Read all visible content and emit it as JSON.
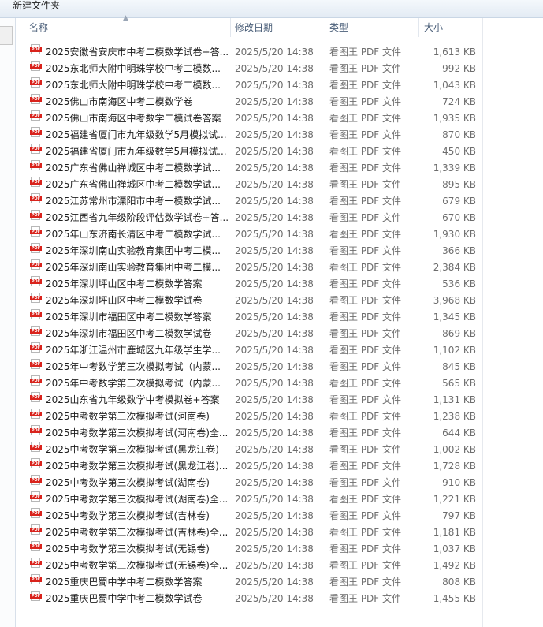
{
  "window": {
    "title": "新建文件夹"
  },
  "columns": {
    "name": "名称",
    "date": "修改日期",
    "type": "类型",
    "size": "大小"
  },
  "files": [
    {
      "name": "2025安徽省安庆市中考二模数学试卷+答...",
      "date": "2025/5/20 14:38",
      "type": "看图王 PDF 文件",
      "size": "1,613 KB"
    },
    {
      "name": "2025东北师大附中明珠学校中考二模数...",
      "date": "2025/5/20 14:38",
      "type": "看图王 PDF 文件",
      "size": "992 KB"
    },
    {
      "name": "2025东北师大附中明珠学校中考二模数...",
      "date": "2025/5/20 14:38",
      "type": "看图王 PDF 文件",
      "size": "1,043 KB"
    },
    {
      "name": "2025佛山市南海区中考二模数学卷",
      "date": "2025/5/20 14:38",
      "type": "看图王 PDF 文件",
      "size": "724 KB"
    },
    {
      "name": "2025佛山市南海区中考数学二模试卷答案",
      "date": "2025/5/20 14:38",
      "type": "看图王 PDF 文件",
      "size": "1,935 KB"
    },
    {
      "name": "2025福建省厦门市九年级数学5月模拟试...",
      "date": "2025/5/20 14:38",
      "type": "看图王 PDF 文件",
      "size": "870 KB"
    },
    {
      "name": "2025福建省厦门市九年级数学5月模拟试...",
      "date": "2025/5/20 14:38",
      "type": "看图王 PDF 文件",
      "size": "450 KB"
    },
    {
      "name": "2025广东省佛山禅城区中考二模数学试...",
      "date": "2025/5/20 14:38",
      "type": "看图王 PDF 文件",
      "size": "1,339 KB"
    },
    {
      "name": "2025广东省佛山禅城区中考二模数学试...",
      "date": "2025/5/20 14:38",
      "type": "看图王 PDF 文件",
      "size": "895 KB"
    },
    {
      "name": "2025江苏常州市溧阳市中考一模数学试...",
      "date": "2025/5/20 14:38",
      "type": "看图王 PDF 文件",
      "size": "679 KB"
    },
    {
      "name": "2025江西省九年级阶段评估数学试卷+答...",
      "date": "2025/5/20 14:38",
      "type": "看图王 PDF 文件",
      "size": "670 KB"
    },
    {
      "name": "2025年山东济南长清区中考二模数学试...",
      "date": "2025/5/20 14:38",
      "type": "看图王 PDF 文件",
      "size": "1,930 KB"
    },
    {
      "name": "2025年深圳南山实验教育集团中考二模...",
      "date": "2025/5/20 14:38",
      "type": "看图王 PDF 文件",
      "size": "366 KB"
    },
    {
      "name": "2025年深圳南山实验教育集团中考二模...",
      "date": "2025/5/20 14:38",
      "type": "看图王 PDF 文件",
      "size": "2,384 KB"
    },
    {
      "name": "2025年深圳坪山区中考二模数学答案",
      "date": "2025/5/20 14:38",
      "type": "看图王 PDF 文件",
      "size": "536 KB"
    },
    {
      "name": "2025年深圳坪山区中考二模数学试卷",
      "date": "2025/5/20 14:38",
      "type": "看图王 PDF 文件",
      "size": "3,968 KB"
    },
    {
      "name": "2025年深圳市福田区中考二模数学答案",
      "date": "2025/5/20 14:38",
      "type": "看图王 PDF 文件",
      "size": "1,345 KB"
    },
    {
      "name": "2025年深圳市福田区中考二模数学试卷",
      "date": "2025/5/20 14:38",
      "type": "看图王 PDF 文件",
      "size": "869 KB"
    },
    {
      "name": "2025年浙江温州市鹿城区九年级学生学...",
      "date": "2025/5/20 14:38",
      "type": "看图王 PDF 文件",
      "size": "1,102 KB"
    },
    {
      "name": "2025年中考数学第三次模拟考试（内蒙...",
      "date": "2025/5/20 14:38",
      "type": "看图王 PDF 文件",
      "size": "845 KB"
    },
    {
      "name": "2025年中考数学第三次模拟考试（内蒙...",
      "date": "2025/5/20 14:38",
      "type": "看图王 PDF 文件",
      "size": "565 KB"
    },
    {
      "name": "2025山东省九年级数学中考模拟卷+答案",
      "date": "2025/5/20 14:38",
      "type": "看图王 PDF 文件",
      "size": "1,131 KB"
    },
    {
      "name": "2025中考数学第三次模拟考试(河南卷)",
      "date": "2025/5/20 14:38",
      "type": "看图王 PDF 文件",
      "size": "1,238 KB"
    },
    {
      "name": "2025中考数学第三次模拟考试(河南卷)全...",
      "date": "2025/5/20 14:38",
      "type": "看图王 PDF 文件",
      "size": "644 KB"
    },
    {
      "name": "2025中考数学第三次模拟考试(黑龙江卷)",
      "date": "2025/5/20 14:38",
      "type": "看图王 PDF 文件",
      "size": "1,002 KB"
    },
    {
      "name": "2025中考数学第三次模拟考试(黑龙江卷)...",
      "date": "2025/5/20 14:38",
      "type": "看图王 PDF 文件",
      "size": "1,728 KB"
    },
    {
      "name": "2025中考数学第三次模拟考试(湖南卷)",
      "date": "2025/5/20 14:38",
      "type": "看图王 PDF 文件",
      "size": "910 KB"
    },
    {
      "name": "2025中考数学第三次模拟考试(湖南卷)全...",
      "date": "2025/5/20 14:38",
      "type": "看图王 PDF 文件",
      "size": "1,221 KB"
    },
    {
      "name": "2025中考数学第三次模拟考试(吉林卷)",
      "date": "2025/5/20 14:38",
      "type": "看图王 PDF 文件",
      "size": "797 KB"
    },
    {
      "name": "2025中考数学第三次模拟考试(吉林卷)全...",
      "date": "2025/5/20 14:38",
      "type": "看图王 PDF 文件",
      "size": "1,181 KB"
    },
    {
      "name": "2025中考数学第三次模拟考试(无锡卷)",
      "date": "2025/5/20 14:38",
      "type": "看图王 PDF 文件",
      "size": "1,037 KB"
    },
    {
      "name": "2025中考数学第三次模拟考试(无锡卷)全...",
      "date": "2025/5/20 14:38",
      "type": "看图王 PDF 文件",
      "size": "1,492 KB"
    },
    {
      "name": "2025重庆巴蜀中学中考二模数学答案",
      "date": "2025/5/20 14:38",
      "type": "看图王 PDF 文件",
      "size": "808 KB"
    },
    {
      "name": "2025重庆巴蜀中学中考二模数学试卷",
      "date": "2025/5/20 14:38",
      "type": "看图王 PDF 文件",
      "size": "1,455 KB"
    }
  ],
  "icons": {
    "file": "pdf-file-icon",
    "badge_text": "PDF",
    "badge_color": "#d9231c"
  }
}
